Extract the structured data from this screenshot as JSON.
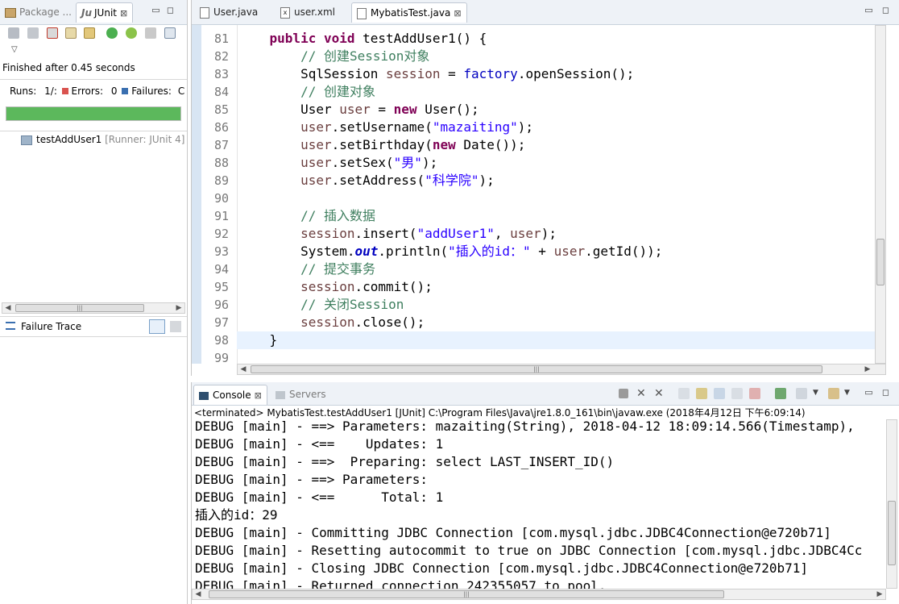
{
  "left": {
    "tabs": [
      {
        "label": "Package ...",
        "icon": "package-explorer-icon"
      },
      {
        "label": "JUnit",
        "icon": "junit-icon",
        "close": "⊠"
      }
    ],
    "status": "Finished after 0.45 seconds",
    "runs_label": "Runs:",
    "runs_value": "1/:",
    "errors_label": "Errors:",
    "errors_value": "0",
    "failures_label": "Failures:",
    "failures_value": "C",
    "progress": 1.0,
    "progress_color": "#5cb85c",
    "test_item": "testAddUser1",
    "test_runner": "[Runner: JUnit 4] (",
    "failure_trace": "Failure Trace"
  },
  "editor": {
    "tabs": [
      {
        "label": "User.java",
        "icon": "java-file-icon"
      },
      {
        "label": "user.xml",
        "icon": "xml-file-icon"
      },
      {
        "label": "MybatisTest.java",
        "icon": "java-file-icon",
        "close": "⊠",
        "active": true
      }
    ],
    "lines": [
      {
        "num": "81",
        "html": "    <span class='kw'>public</span> <span class='kw'>void</span> testAddUser1() {"
      },
      {
        "num": "82",
        "html": "        <span class='cm'>// 创建Session对象</span>"
      },
      {
        "num": "83",
        "html": "        SqlSession <span class='vr'>session</span> = <span class='fd'>factory</span>.openSession();"
      },
      {
        "num": "84",
        "html": "        <span class='cm'>// 创建对象</span>"
      },
      {
        "num": "85",
        "html": "        User <span class='vr'>user</span> = <span class='kw'>new</span> User();"
      },
      {
        "num": "86",
        "html": "        <span class='vr'>user</span>.setUsername(<span class='st'>\"mazaiting\"</span>);"
      },
      {
        "num": "87",
        "html": "        <span class='vr'>user</span>.setBirthday(<span class='kw'>new</span> Date());"
      },
      {
        "num": "88",
        "html": "        <span class='vr'>user</span>.setSex(<span class='st'>\"男\"</span>);"
      },
      {
        "num": "89",
        "html": "        <span class='vr'>user</span>.setAddress(<span class='st'>\"科学院\"</span>);"
      },
      {
        "num": "90",
        "html": ""
      },
      {
        "num": "91",
        "html": "        <span class='cm'>// 插入数据</span>"
      },
      {
        "num": "92",
        "html": "        <span class='vr'>session</span>.insert(<span class='st'>\"addUser1\"</span>, <span class='vr'>user</span>);"
      },
      {
        "num": "93",
        "html": "        System.<span class='fi'>out</span>.println(<span class='st'>\"插入的id：\"</span> + <span class='vr'>user</span>.getId());"
      },
      {
        "num": "94",
        "html": "        <span class='cm'>// 提交事务</span>"
      },
      {
        "num": "95",
        "html": "        <span class='vr'>session</span>.commit();"
      },
      {
        "num": "96",
        "html": "        <span class='cm'>// 关闭Session</span>"
      },
      {
        "num": "97",
        "html": "        <span class='vr'>session</span>.close();"
      },
      {
        "num": "98",
        "html": "    }"
      },
      {
        "num": "99",
        "html": ""
      }
    ],
    "highlight_line": "98",
    "highlight_color": "#e8f2fe"
  },
  "console": {
    "tabs": [
      {
        "label": "Console",
        "icon": "console-icon",
        "close": "⊠"
      },
      {
        "label": "Servers",
        "icon": "servers-icon"
      }
    ],
    "terminated": "<terminated> MybatisTest.testAddUser1 [JUnit] C:\\Program Files\\Java\\jre1.8.0_161\\bin\\javaw.exe (2018年4月12日 下午6:09:14)",
    "lines": [
      "DEBUG [main] - ==> Parameters: mazaiting(String), 2018-04-12 18:09:14.566(Timestamp),",
      "DEBUG [main] - <==    Updates: 1",
      "DEBUG [main] - ==>  Preparing: select LAST_INSERT_ID()",
      "DEBUG [main] - ==> Parameters: ",
      "DEBUG [main] - <==      Total: 1",
      "插入的id：29",
      "DEBUG [main] - Committing JDBC Connection [com.mysql.jdbc.JDBC4Connection@e720b71]",
      "DEBUG [main] - Resetting autocommit to true on JDBC Connection [com.mysql.jdbc.JDBC4Cc",
      "DEBUG [main] - Closing JDBC Connection [com.mysql.jdbc.JDBC4Connection@e720b71]",
      "DEBUG [main] - Returned connection 242355057 to pool."
    ]
  },
  "icons": {
    "minimize": "▭",
    "maximize": "◻",
    "scroll_left": "◀",
    "scroll_right": "▶",
    "scroll_up": "▲",
    "scroll_down": "▼",
    "dropdown": "▽",
    "thumb_grip": "|||"
  }
}
